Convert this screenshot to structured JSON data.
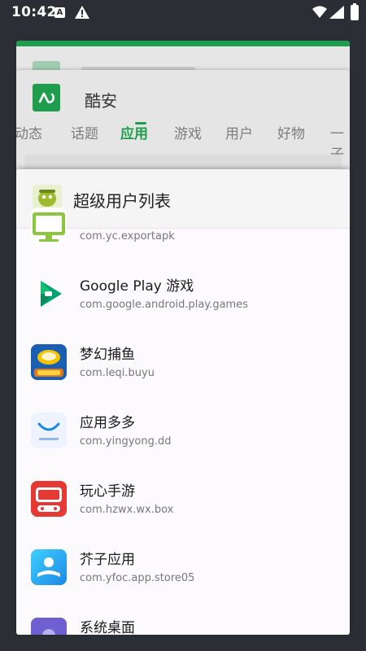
{
  "status_bar": {
    "time": "10:42",
    "icons": [
      "a-notification-icon",
      "warning-icon",
      "wifi-icon",
      "signal-icon",
      "battery-icon"
    ]
  },
  "recents": {
    "coolapk": {
      "title": "酷安",
      "tabs": [
        "动态",
        "话题",
        "应用",
        "游戏",
        "用户",
        "好物",
        "一子"
      ],
      "active_tab": "应用",
      "accent": "#1e9e4d"
    },
    "front": {
      "title": "超级用户列表",
      "items": [
        {
          "name": "",
          "package": "com.yc.exportapk",
          "icon": "monitor-icon"
        },
        {
          "name": "Google Play 游戏",
          "package": "com.google.android.play.games",
          "icon": "play-games-icon"
        },
        {
          "name": "梦幻捕鱼",
          "package": "com.leqi.buyu",
          "icon": "fishing-game-icon"
        },
        {
          "name": "应用多多",
          "package": "com.yingyong.dd",
          "icon": "yingyongduoduo-icon"
        },
        {
          "name": "玩心手游",
          "package": "com.hzwx.wx.box",
          "icon": "wanxin-icon"
        },
        {
          "name": "芥子应用",
          "package": "com.yfoc.app.store05",
          "icon": "jiezi-icon"
        },
        {
          "name": "系统桌面",
          "package": "",
          "icon": "launcher-icon"
        }
      ]
    }
  }
}
